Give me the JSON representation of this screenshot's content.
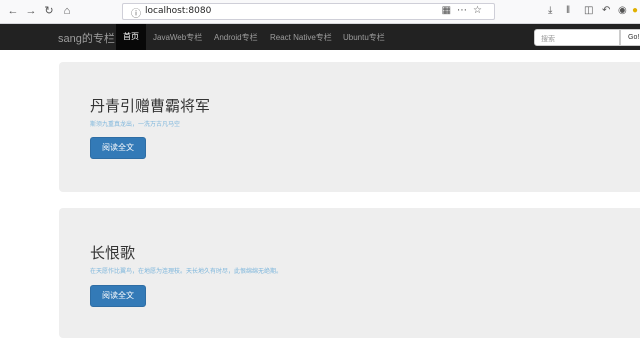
{
  "browser": {
    "url_text": "localhost:8080",
    "url_host": "localhost",
    "url_port": ":8080"
  },
  "navbar": {
    "brand": "sang的专栏",
    "items": [
      "首页",
      "JavaWeb专栏",
      "Android专栏",
      "React Native专栏",
      "Ubuntu专栏"
    ],
    "active_index": 0,
    "search_placeholder": "搜索",
    "go_label": "Go!"
  },
  "articles": [
    {
      "title": "丹青引赠曹霸将军",
      "excerpt": "斯须九重真龙出，一洗万古凡马空",
      "button": "阅读全文"
    },
    {
      "title": "长恨歌",
      "excerpt": "在天愿作比翼鸟，在地愿为连理枝。天长地久有时尽，此恨绵绵无绝期。",
      "button": "阅读全文"
    }
  ]
}
